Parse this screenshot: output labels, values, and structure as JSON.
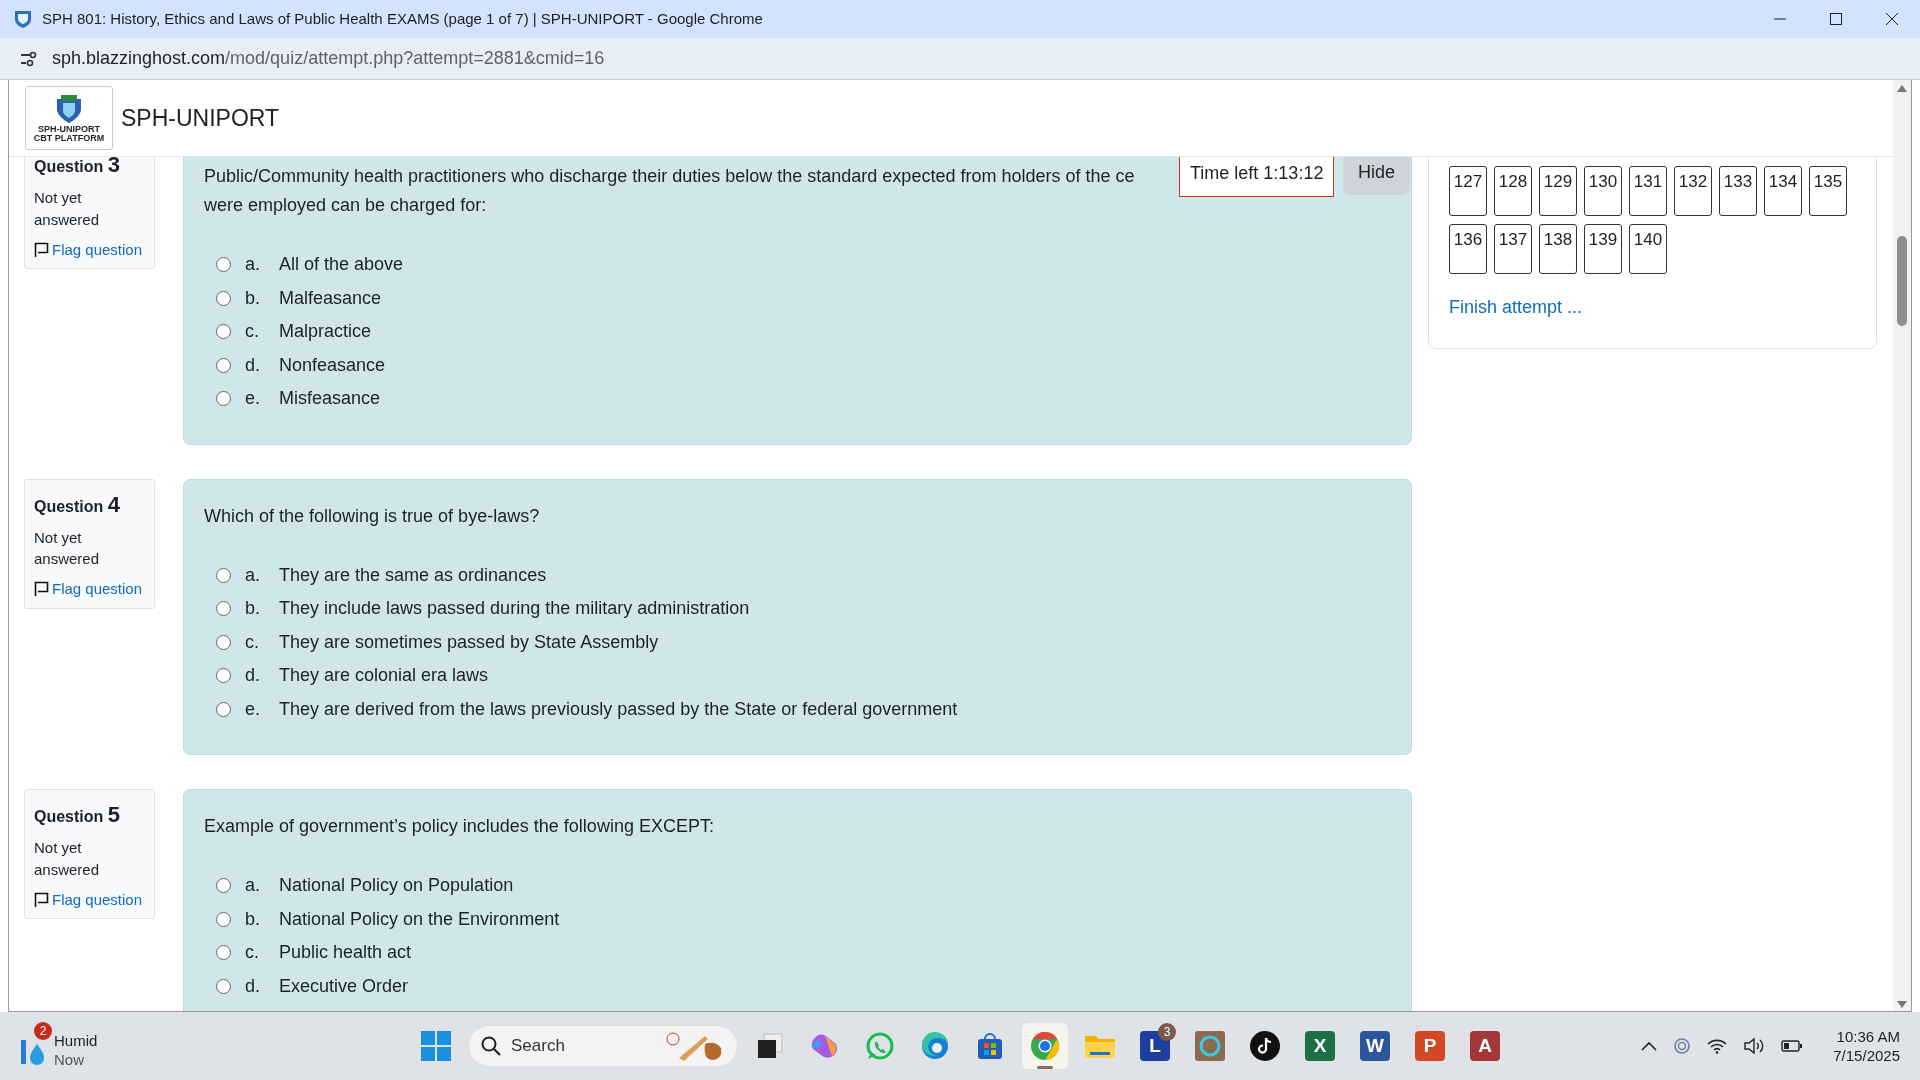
{
  "window": {
    "title": "SPH 801: History, Ethics and Laws of Public Health EXAMS (page 1 of 7) | SPH-UNIPORT - Google Chrome"
  },
  "address_bar": {
    "host": "sph.blazzinghost.com",
    "path": "/mod/quiz/attempt.php?attempt=2881&cmid=16"
  },
  "header": {
    "logo_lines": [
      "SPH-UNIPORT",
      "CBT PLATFORM"
    ],
    "site_name": "SPH-UNIPORT"
  },
  "questions": [
    {
      "label": "Question",
      "number": "3",
      "status": "Not yet answered",
      "flag": "Flag question",
      "text_lines": [
        "Public/Community health practitioners who discharge their duties below the standard expected from holders of the ce",
        "were employed can be charged for:"
      ],
      "options": [
        {
          "letter": "a.",
          "text": "All of the above",
          "selected": false
        },
        {
          "letter": "b.",
          "text": "Malfeasance",
          "selected": false
        },
        {
          "letter": "c.",
          "text": "Malpractice",
          "selected": false
        },
        {
          "letter": "d.",
          "text": "Nonfeasance",
          "selected": false
        },
        {
          "letter": "e.",
          "text": "Misfeasance",
          "selected": false
        }
      ]
    },
    {
      "label": "Question",
      "number": "4",
      "status": "Not yet answered",
      "flag": "Flag question",
      "text_lines": [
        "Which of the following is true of bye-laws?"
      ],
      "options": [
        {
          "letter": "a.",
          "text": "They are the same as ordinances",
          "selected": false
        },
        {
          "letter": "b.",
          "text": "They include laws passed during the military administration",
          "selected": false
        },
        {
          "letter": "c.",
          "text": "They are sometimes passed by State Assembly",
          "selected": false
        },
        {
          "letter": "d.",
          "text": "They are colonial era laws",
          "selected": false
        },
        {
          "letter": "e.",
          "text": "They are derived from the laws previously passed by the State or federal government",
          "selected": false
        }
      ]
    },
    {
      "label": "Question",
      "number": "5",
      "status": "Not yet answered",
      "flag": "Flag question",
      "text_lines": [
        "Example of government’s policy includes the following EXCEPT:"
      ],
      "options": [
        {
          "letter": "a.",
          "text": "National Policy on Population",
          "selected": false
        },
        {
          "letter": "b.",
          "text": "National Policy on the Environment",
          "selected": false
        },
        {
          "letter": "c.",
          "text": "Public health act",
          "selected": false
        },
        {
          "letter": "d.",
          "text": "Executive Order",
          "selected": false
        }
      ]
    }
  ],
  "timer": {
    "text": "Time left 1:13:12",
    "button": "Hide"
  },
  "quiz_nav": {
    "buttons": [
      "127",
      "128",
      "129",
      "130",
      "131",
      "132",
      "133",
      "134",
      "135",
      "136",
      "137",
      "138",
      "139",
      "140"
    ],
    "finish": "Finish attempt ..."
  },
  "taskbar": {
    "weather": {
      "badge": "2",
      "title": "Humid",
      "subtitle": "Now"
    },
    "search_placeholder": "Search",
    "apps": [
      {
        "kind": "start",
        "selected": false
      },
      {
        "kind": "search",
        "selected": false
      },
      {
        "kind": "taskview",
        "selected": false
      },
      {
        "kind": "copilot",
        "selected": false
      },
      {
        "kind": "chat",
        "selected": false
      },
      {
        "kind": "edge",
        "selected": false
      },
      {
        "kind": "store",
        "selected": false
      },
      {
        "kind": "chrome",
        "selected": true
      },
      {
        "kind": "folder",
        "selected": false
      },
      {
        "kind": "tile",
        "glyph": "L",
        "badge": "3",
        "color": "#1c3f9e",
        "selected": false
      },
      {
        "kind": "ring",
        "selected": false
      },
      {
        "kind": "note",
        "selected": false
      },
      {
        "kind": "tile",
        "glyph": "X",
        "color": "#1d7044",
        "selected": false
      },
      {
        "kind": "tile",
        "glyph": "W",
        "color": "#2b579a",
        "selected": false
      },
      {
        "kind": "tile",
        "glyph": "P",
        "color": "#d24726",
        "selected": false
      },
      {
        "kind": "tile",
        "glyph": "A",
        "color": "#a4373a",
        "selected": false
      }
    ],
    "time": "10:36 AM",
    "date": "7/15/2025"
  }
}
